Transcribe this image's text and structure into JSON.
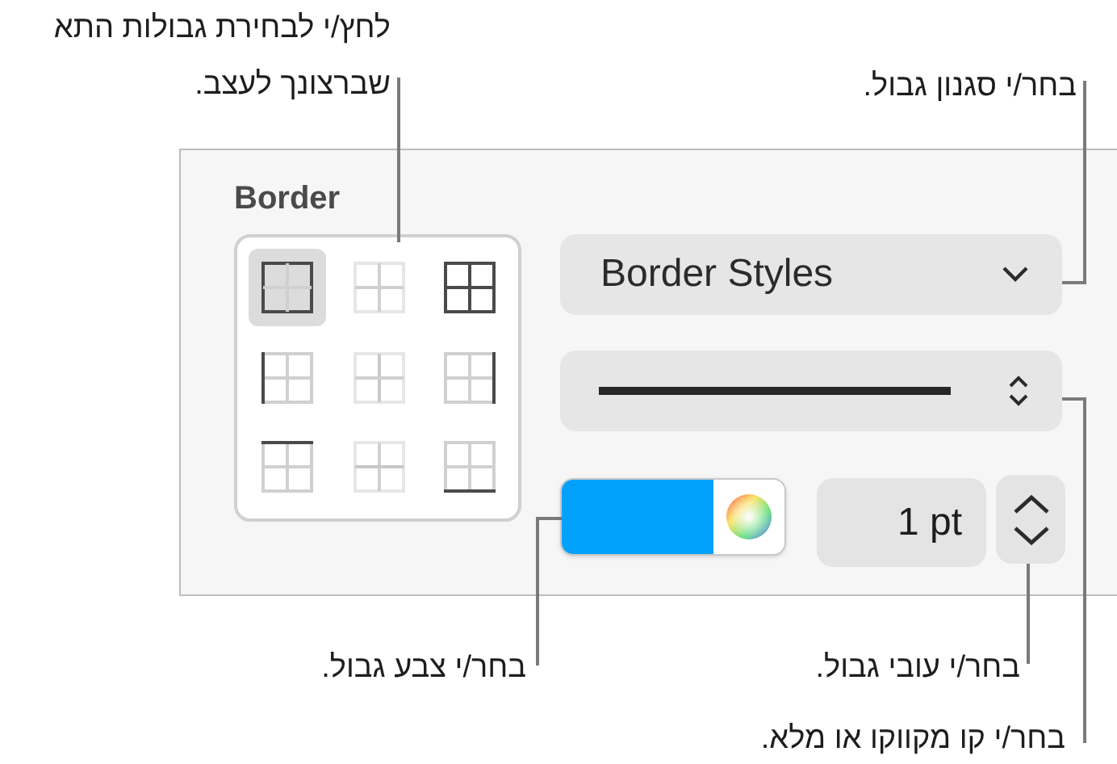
{
  "panel": {
    "title": "Border",
    "border_cells": [
      {
        "kind": "outer",
        "selected": true
      },
      {
        "kind": "inner",
        "selected": false
      },
      {
        "kind": "all",
        "selected": false
      },
      {
        "kind": "left",
        "selected": false
      },
      {
        "kind": "inner_vertical",
        "selected": false
      },
      {
        "kind": "right",
        "selected": false
      },
      {
        "kind": "top",
        "selected": false
      },
      {
        "kind": "inner_horizontal",
        "selected": false
      },
      {
        "kind": "bottom",
        "selected": false
      }
    ],
    "style_menu": {
      "value": "Border Styles"
    },
    "line_style": {
      "kind": "solid"
    },
    "border_color": {
      "color": "#02a1fb"
    },
    "width_field": {
      "value": "1 pt"
    }
  },
  "callouts": [
    {
      "text": "בחר/י סגנון גבול."
    },
    {
      "text": "לחץ/י לבחירת גבולות התא שברצונך לעצב."
    },
    {
      "text": "בחר/י עובי גבול."
    },
    {
      "text": "בחר/י צבע גבול."
    },
    {
      "text": "בחר/י קו מקווקו או מלא."
    }
  ]
}
